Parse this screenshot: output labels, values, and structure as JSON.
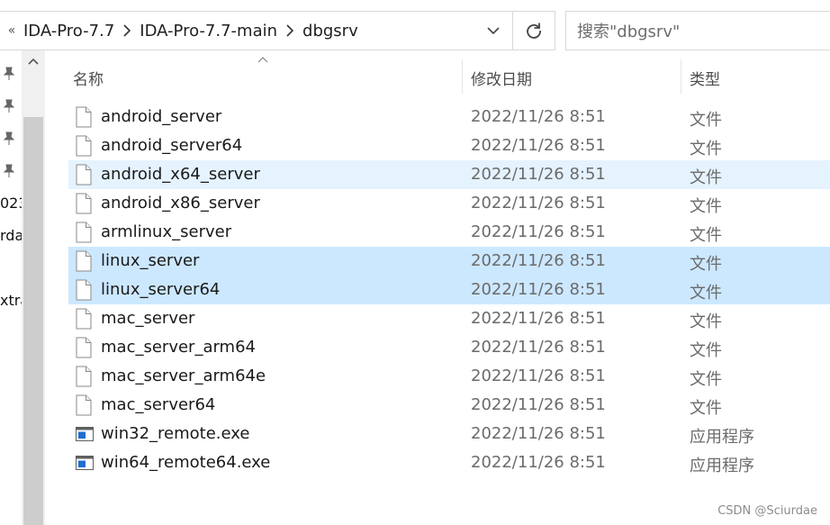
{
  "address_bar": {
    "overflow": "«",
    "breadcrumbs": [
      "IDA-Pro-7.7",
      "IDA-Pro-7.7-main",
      "dbgsrv"
    ]
  },
  "search": {
    "placeholder": "搜索\"dbgsrv\""
  },
  "nav_fragments": [
    "023",
    "rda",
    "xtra"
  ],
  "columns": {
    "name": "名称",
    "date": "修改日期",
    "type": "类型"
  },
  "files": [
    {
      "name": "android_server",
      "date": "2022/11/26 8:51",
      "type": "文件",
      "icon": "file-icon",
      "state": "normal"
    },
    {
      "name": "android_server64",
      "date": "2022/11/26 8:51",
      "type": "文件",
      "icon": "file-icon",
      "state": "normal"
    },
    {
      "name": "android_x64_server",
      "date": "2022/11/26 8:51",
      "type": "文件",
      "icon": "file-icon",
      "state": "hover"
    },
    {
      "name": "android_x86_server",
      "date": "2022/11/26 8:51",
      "type": "文件",
      "icon": "file-icon",
      "state": "normal"
    },
    {
      "name": "armlinux_server",
      "date": "2022/11/26 8:51",
      "type": "文件",
      "icon": "file-icon",
      "state": "normal"
    },
    {
      "name": "linux_server",
      "date": "2022/11/26 8:51",
      "type": "文件",
      "icon": "file-icon",
      "state": "selected"
    },
    {
      "name": "linux_server64",
      "date": "2022/11/26 8:51",
      "type": "文件",
      "icon": "file-icon",
      "state": "selected"
    },
    {
      "name": "mac_server",
      "date": "2022/11/26 8:51",
      "type": "文件",
      "icon": "file-icon",
      "state": "normal"
    },
    {
      "name": "mac_server_arm64",
      "date": "2022/11/26 8:51",
      "type": "文件",
      "icon": "file-icon",
      "state": "normal"
    },
    {
      "name": "mac_server_arm64e",
      "date": "2022/11/26 8:51",
      "type": "文件",
      "icon": "file-icon",
      "state": "normal"
    },
    {
      "name": "mac_server64",
      "date": "2022/11/26 8:51",
      "type": "文件",
      "icon": "file-icon",
      "state": "normal"
    },
    {
      "name": "win32_remote.exe",
      "date": "2022/11/26 8:51",
      "type": "应用程序",
      "icon": "exe-icon",
      "state": "normal"
    },
    {
      "name": "win64_remote64.exe",
      "date": "2022/11/26 8:51",
      "type": "应用程序",
      "icon": "exe-icon",
      "state": "normal"
    }
  ],
  "colors": {
    "selected": "#cce8ff",
    "hover": "#e5f3ff",
    "exe_blue": "#1e6fd0"
  },
  "watermark": "CSDN @Sciurdae"
}
